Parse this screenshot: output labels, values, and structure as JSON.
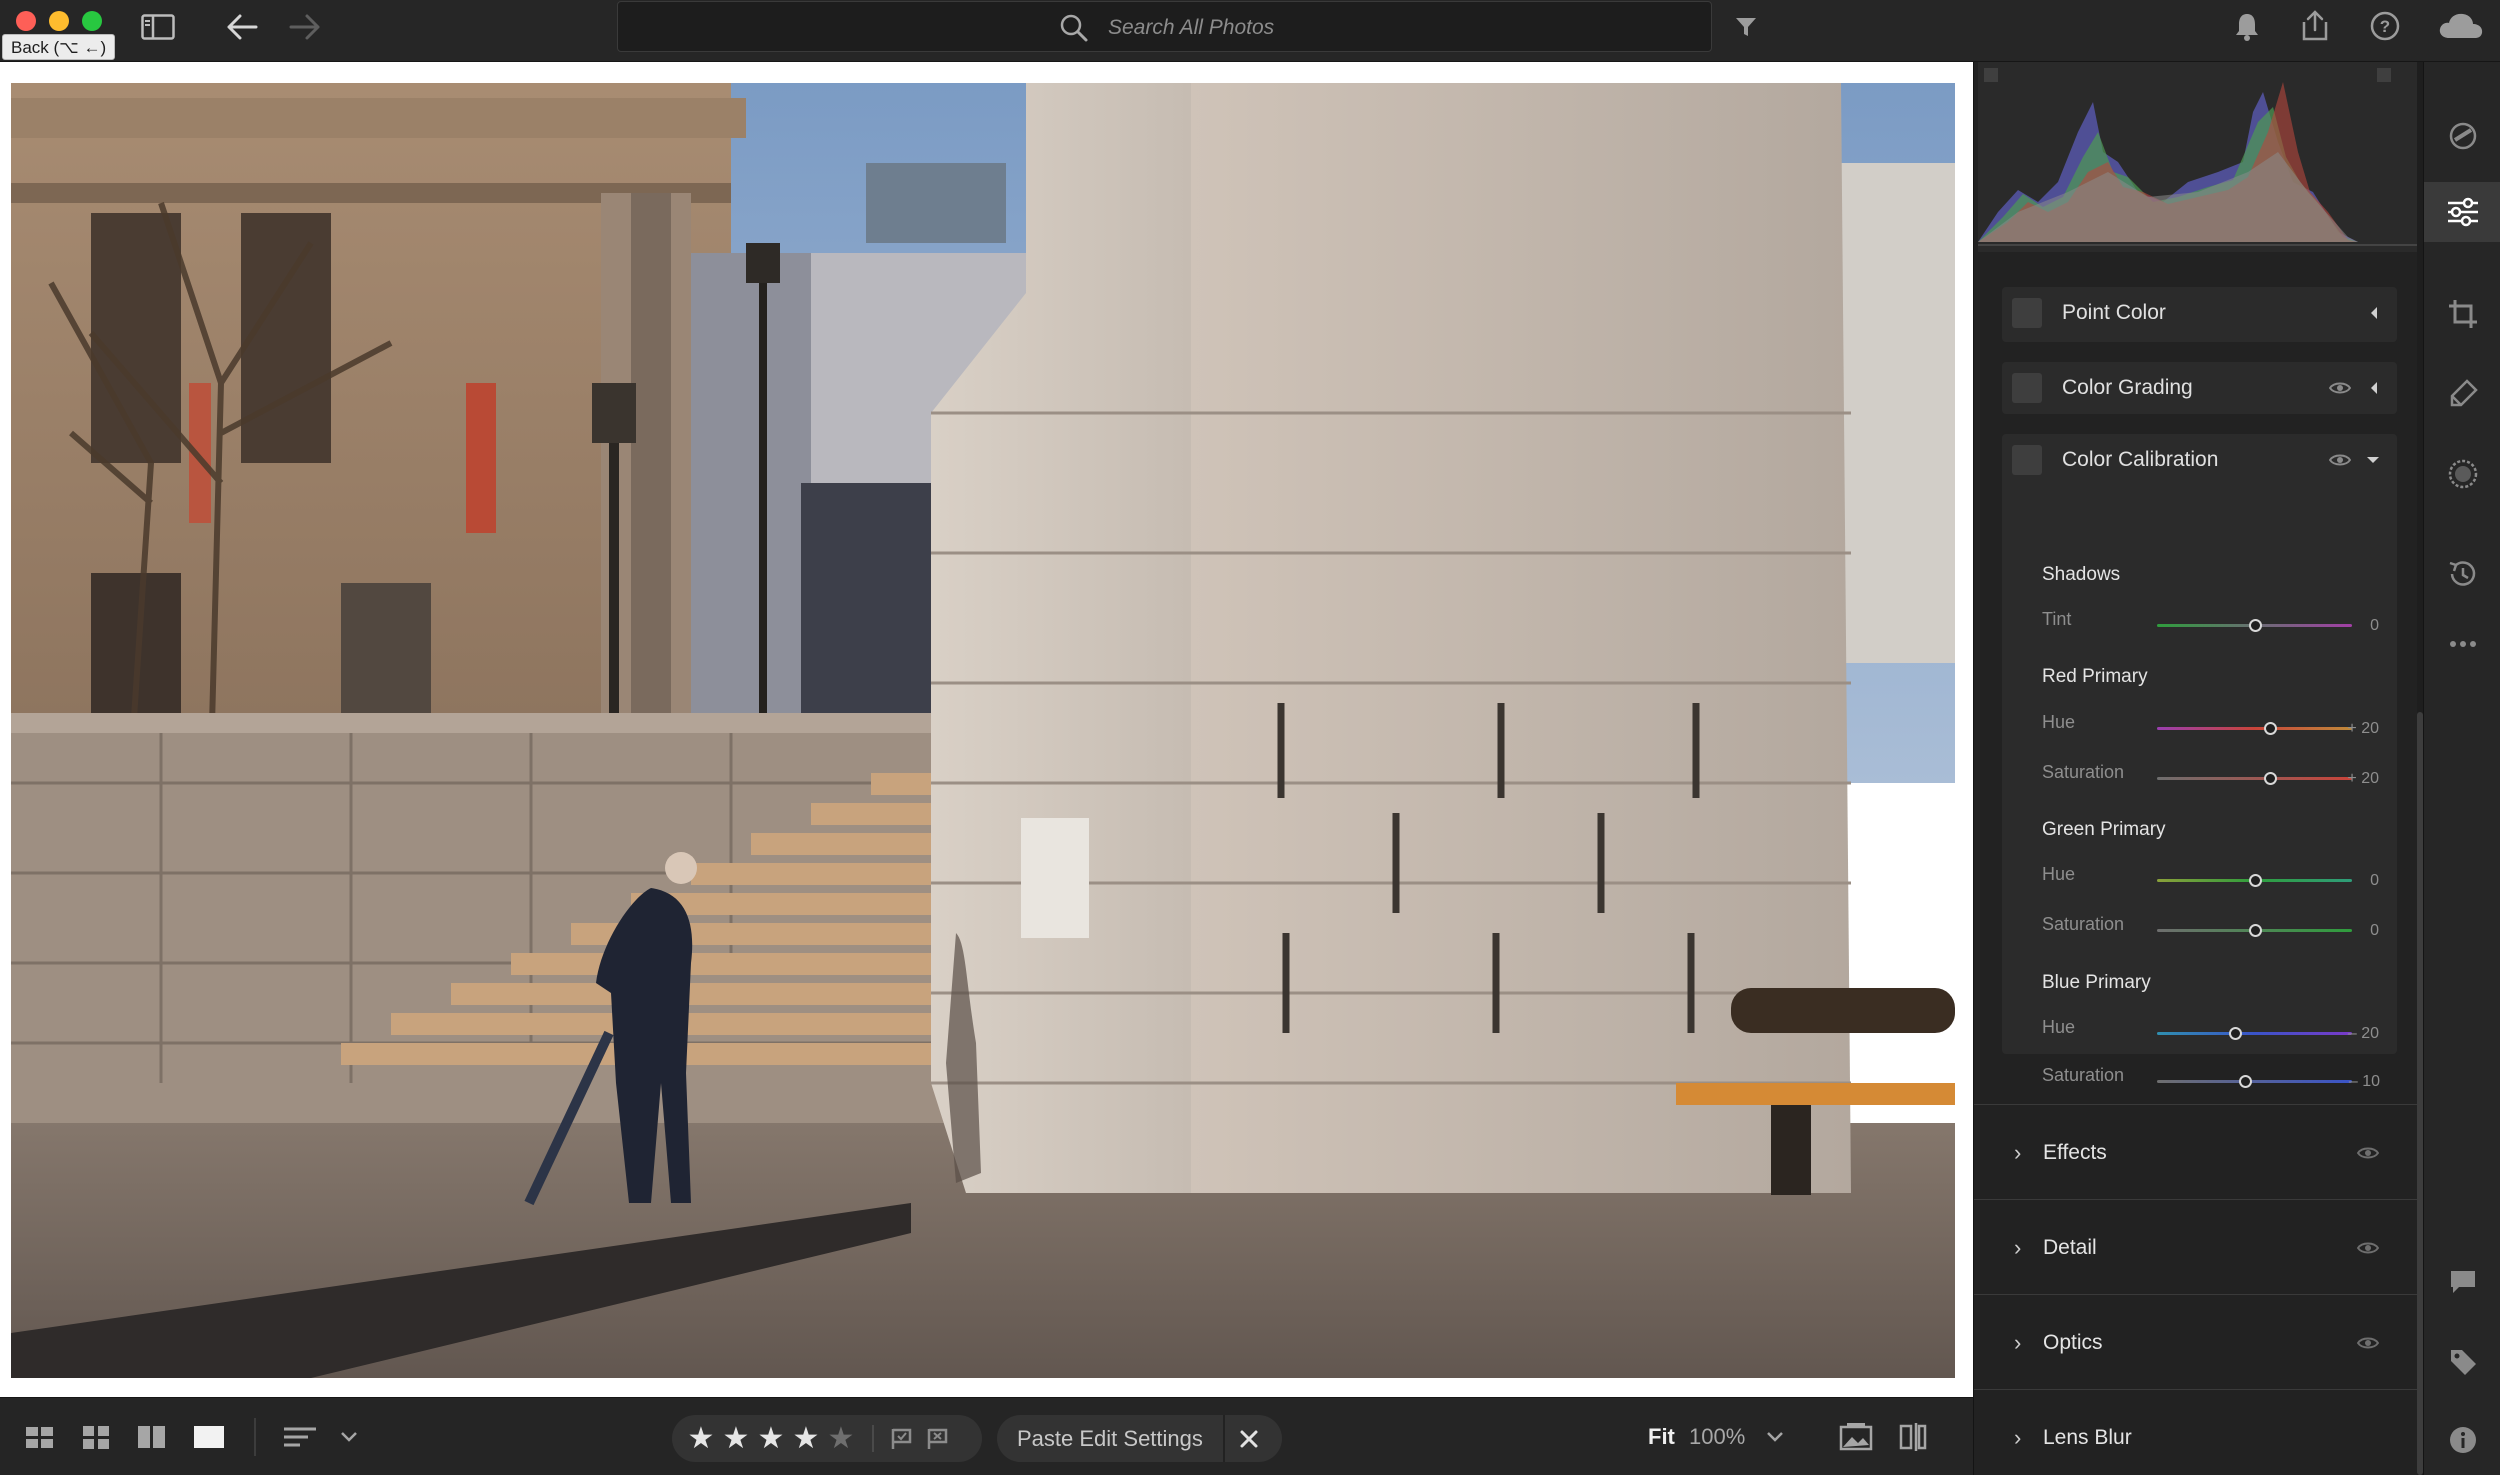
{
  "window": {
    "tooltip": "Back (⌥ ←)"
  },
  "search": {
    "placeholder": "Search All Photos"
  },
  "rating": {
    "stars": 4,
    "max": 5
  },
  "bottombar": {
    "paste_label": "Paste Edit Settings",
    "fit_label": "Fit",
    "zoom_label": "100%"
  },
  "panel": {
    "point_color": "Point Color",
    "color_grading": "Color Grading",
    "color_calibration": {
      "title": "Color Calibration",
      "groups": [
        {
          "title": "Shadows",
          "rows": [
            {
              "label": "Tint",
              "value": "0",
              "pos": 0.5
            }
          ]
        },
        {
          "title": "Red Primary",
          "rows": [
            {
              "label": "Hue",
              "value": "+ 20",
              "pos": 0.6
            },
            {
              "label": "Saturation",
              "value": "+ 20",
              "pos": 0.6
            }
          ]
        },
        {
          "title": "Green Primary",
          "rows": [
            {
              "label": "Hue",
              "value": "0",
              "pos": 0.5
            },
            {
              "label": "Saturation",
              "value": "0",
              "pos": 0.5
            }
          ]
        },
        {
          "title": "Blue Primary",
          "rows": [
            {
              "label": "Hue",
              "value": "– 20",
              "pos": 0.4
            },
            {
              "label": "Saturation",
              "value": "– 10",
              "pos": 0.45
            }
          ]
        }
      ]
    },
    "collapsed_sections": [
      "Effects",
      "Detail",
      "Optics",
      "Lens Blur"
    ]
  },
  "colors": {
    "accent_text": "#e0e0e0",
    "panel_bg": "#222222",
    "card_bg": "#2b2b2b"
  },
  "icons": {
    "top": [
      "sidebar-toggle-icon",
      "back-arrow-icon",
      "forward-arrow-icon",
      "search-icon",
      "filter-icon",
      "bell-icon",
      "share-icon",
      "help-icon",
      "cloud-icon"
    ],
    "tools": [
      "presets-icon",
      "edit-sliders-icon",
      "crop-icon",
      "healing-icon",
      "masking-icon",
      "history-icon",
      "more-icon",
      "comment-icon",
      "tag-icon",
      "info-icon"
    ]
  }
}
